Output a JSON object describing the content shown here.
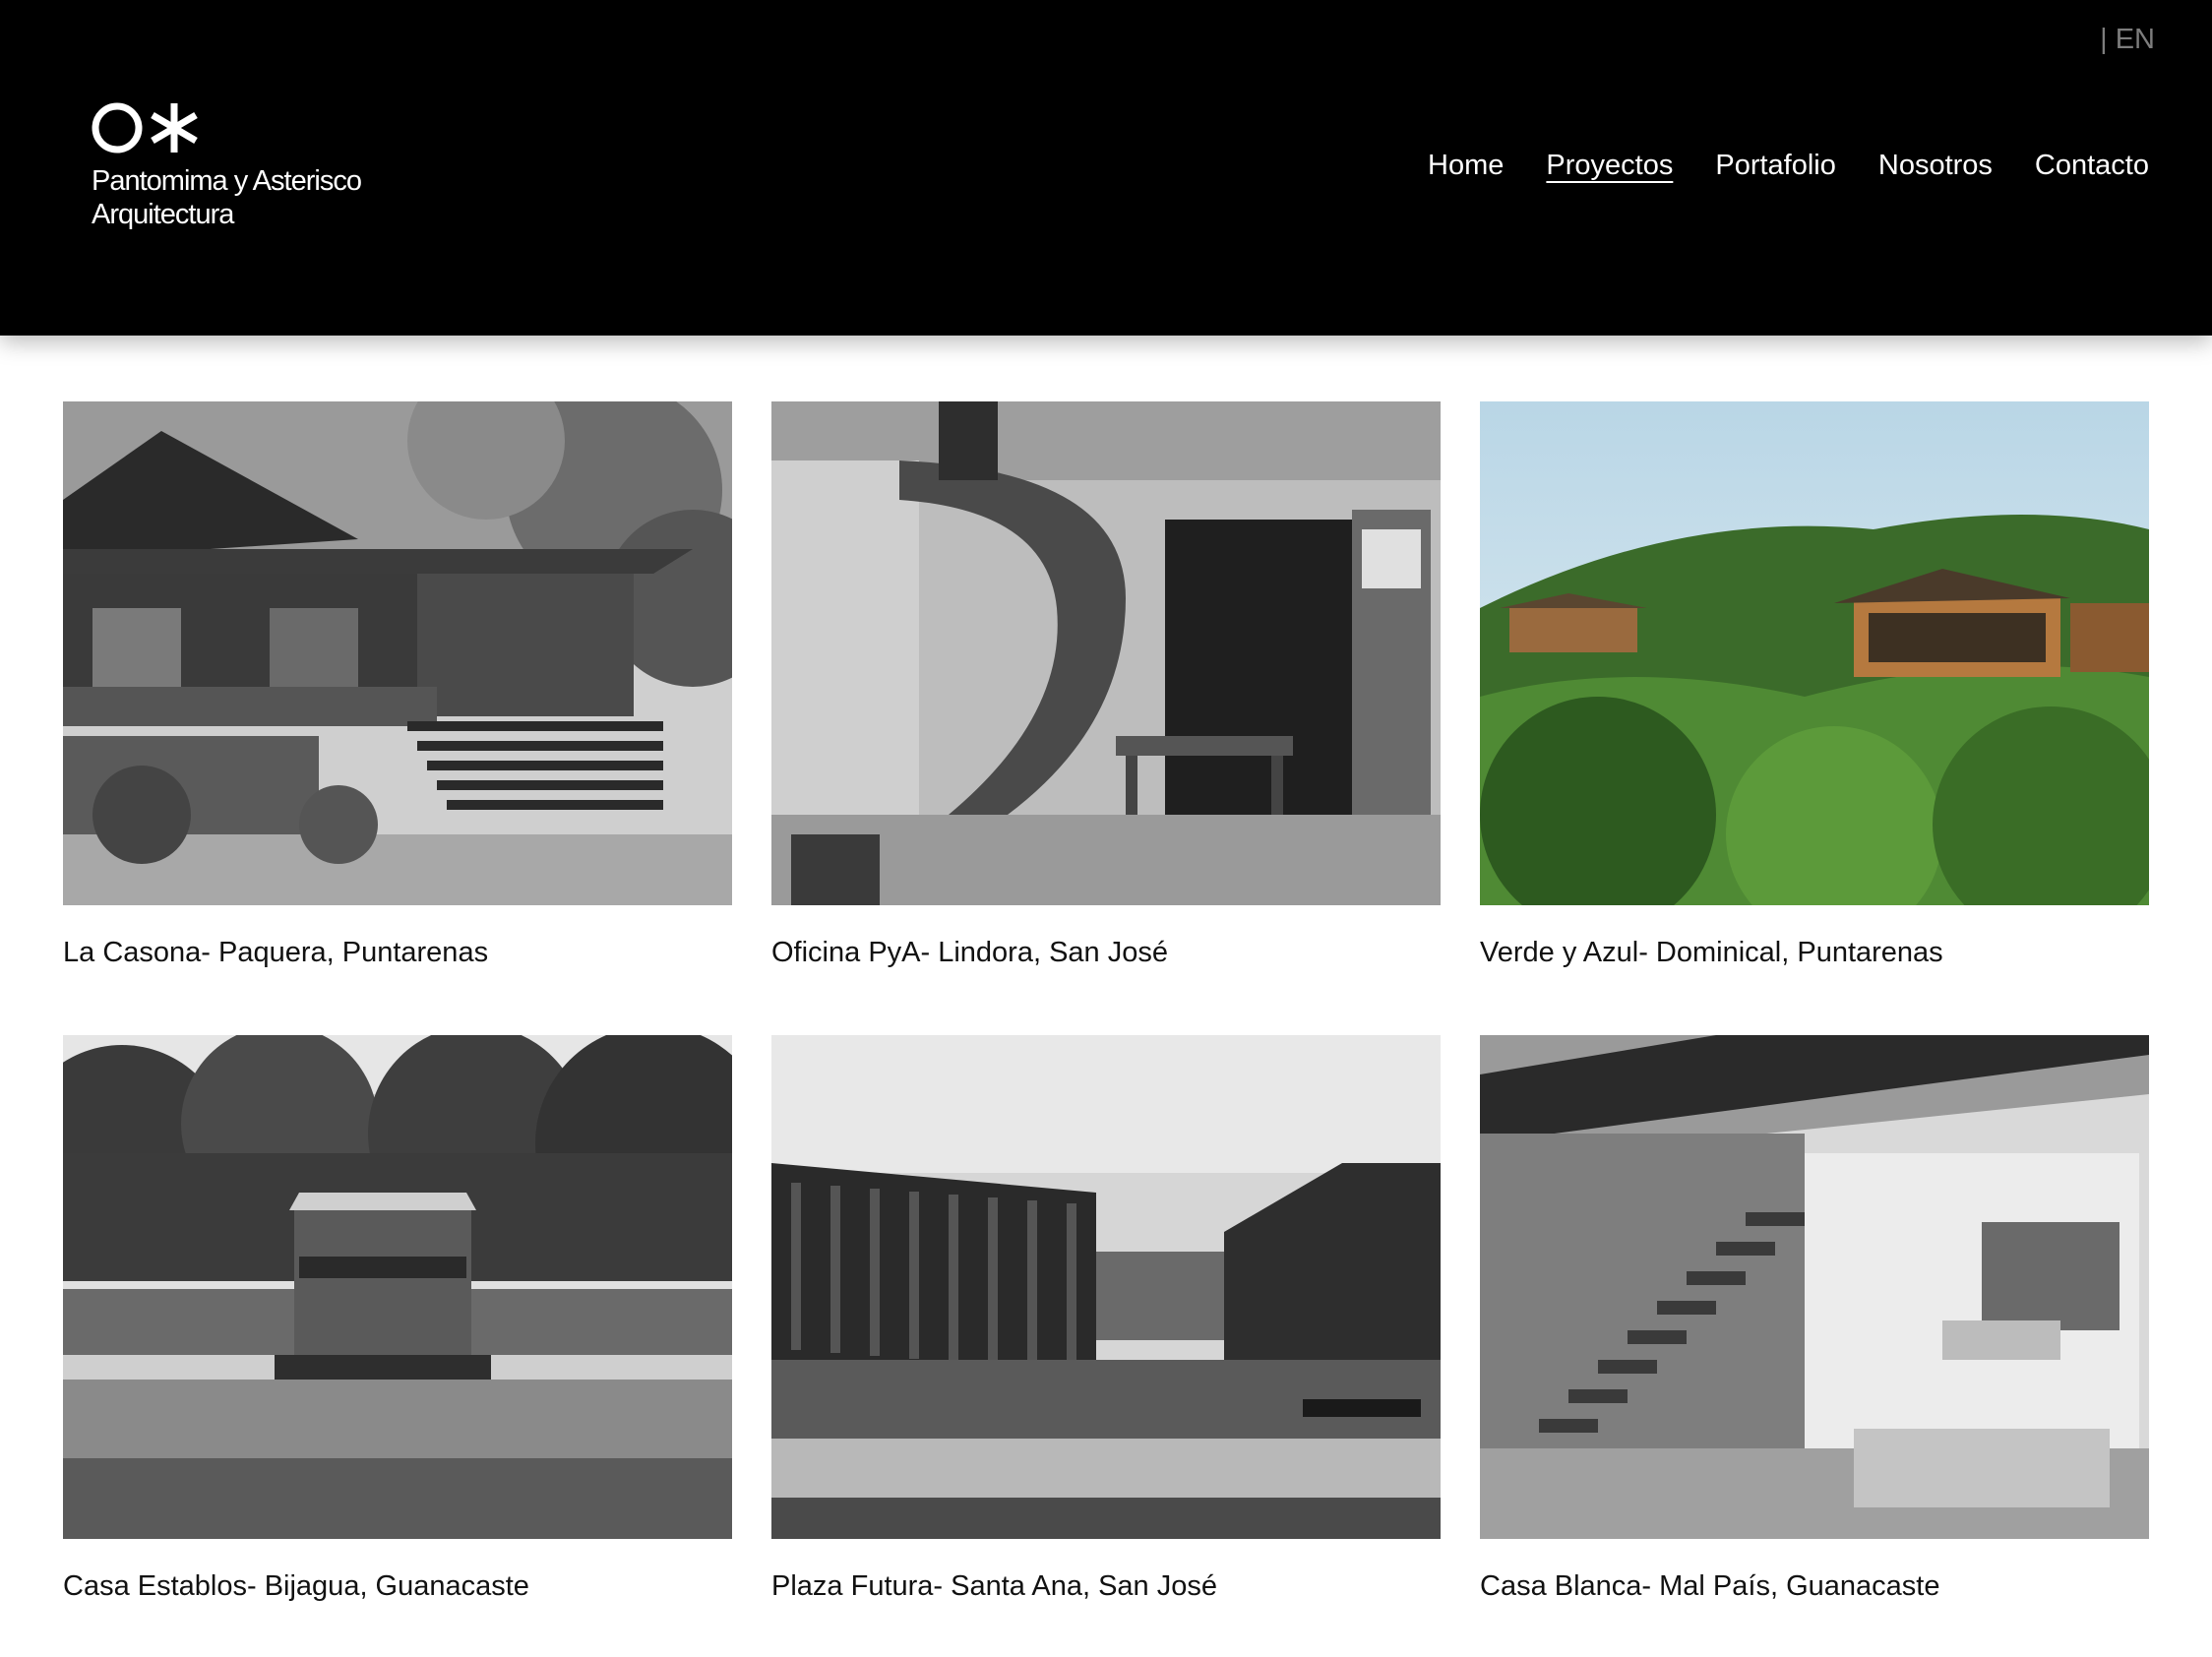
{
  "header": {
    "lang": "| EN",
    "logo_line1": "Pantomima y Asterisco",
    "logo_line2": "Arquitectura",
    "nav": [
      {
        "label": "Home",
        "active": false
      },
      {
        "label": "Proyectos",
        "active": true
      },
      {
        "label": "Portafolio",
        "active": false
      },
      {
        "label": "Nosotros",
        "active": false
      },
      {
        "label": "Contacto",
        "active": false
      }
    ]
  },
  "projects": [
    {
      "caption": "La Casona- Paquera, Puntarenas",
      "image": "wooden-house-bw"
    },
    {
      "caption": "Oficina PyA- Lindora, San José",
      "image": "office-spiral-stair-bw"
    },
    {
      "caption": "Verde y Azul- Dominical, Puntarenas",
      "image": "jungle-houses-color"
    },
    {
      "caption": "Casa Establos- Bijagua, Guanacaste",
      "image": "stable-house-forest-bw"
    },
    {
      "caption": "Plaza Futura- Santa Ana, San José",
      "image": "commercial-building-bw"
    },
    {
      "caption": "Casa Blanca- Mal País, Guanacaste",
      "image": "interior-floating-stair-bw"
    }
  ],
  "colors": {
    "header_bg": "#000000",
    "nav_text": "#ffffff",
    "lang_text": "#7d7d7d",
    "caption_text": "#111111"
  }
}
